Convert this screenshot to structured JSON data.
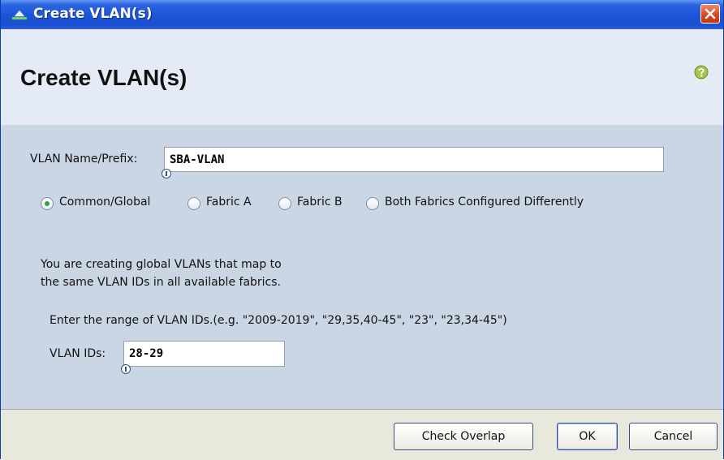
{
  "window": {
    "title": "Create VLAN(s)"
  },
  "header": {
    "title": "Create VLAN(s)"
  },
  "form": {
    "name_label": "VLAN Name/Prefix:",
    "name_value": "SBA-VLAN",
    "radios": [
      {
        "label": "Common/Global",
        "checked": true
      },
      {
        "label": "Fabric A",
        "checked": false
      },
      {
        "label": "Fabric B",
        "checked": false
      },
      {
        "label": "Both Fabrics Configured Differently",
        "checked": false
      }
    ],
    "info_line1": "You are creating global VLANs that map to",
    "info_line2": "the same VLAN IDs in all available fabrics.",
    "range_hint": "Enter the range of VLAN IDs.(e.g. \"2009-2019\", \"29,35,40-45\", \"23\", \"23,34-45\")",
    "ids_label": "VLAN IDs:",
    "ids_value": "28-29"
  },
  "buttons": {
    "check_overlap": "Check Overlap",
    "ok": "OK",
    "cancel": "Cancel"
  },
  "colors": {
    "title_bar": "#1c54d8",
    "panel": "#cbd6e5",
    "header": "#e4ebf6",
    "footer": "#e9e8dc",
    "radio_dot": "#2aa63a",
    "close": "#d8451c"
  },
  "icons": {
    "title": "vlan-network-icon",
    "close": "close-icon",
    "help": "help-icon",
    "info": "info-marker-icon"
  }
}
